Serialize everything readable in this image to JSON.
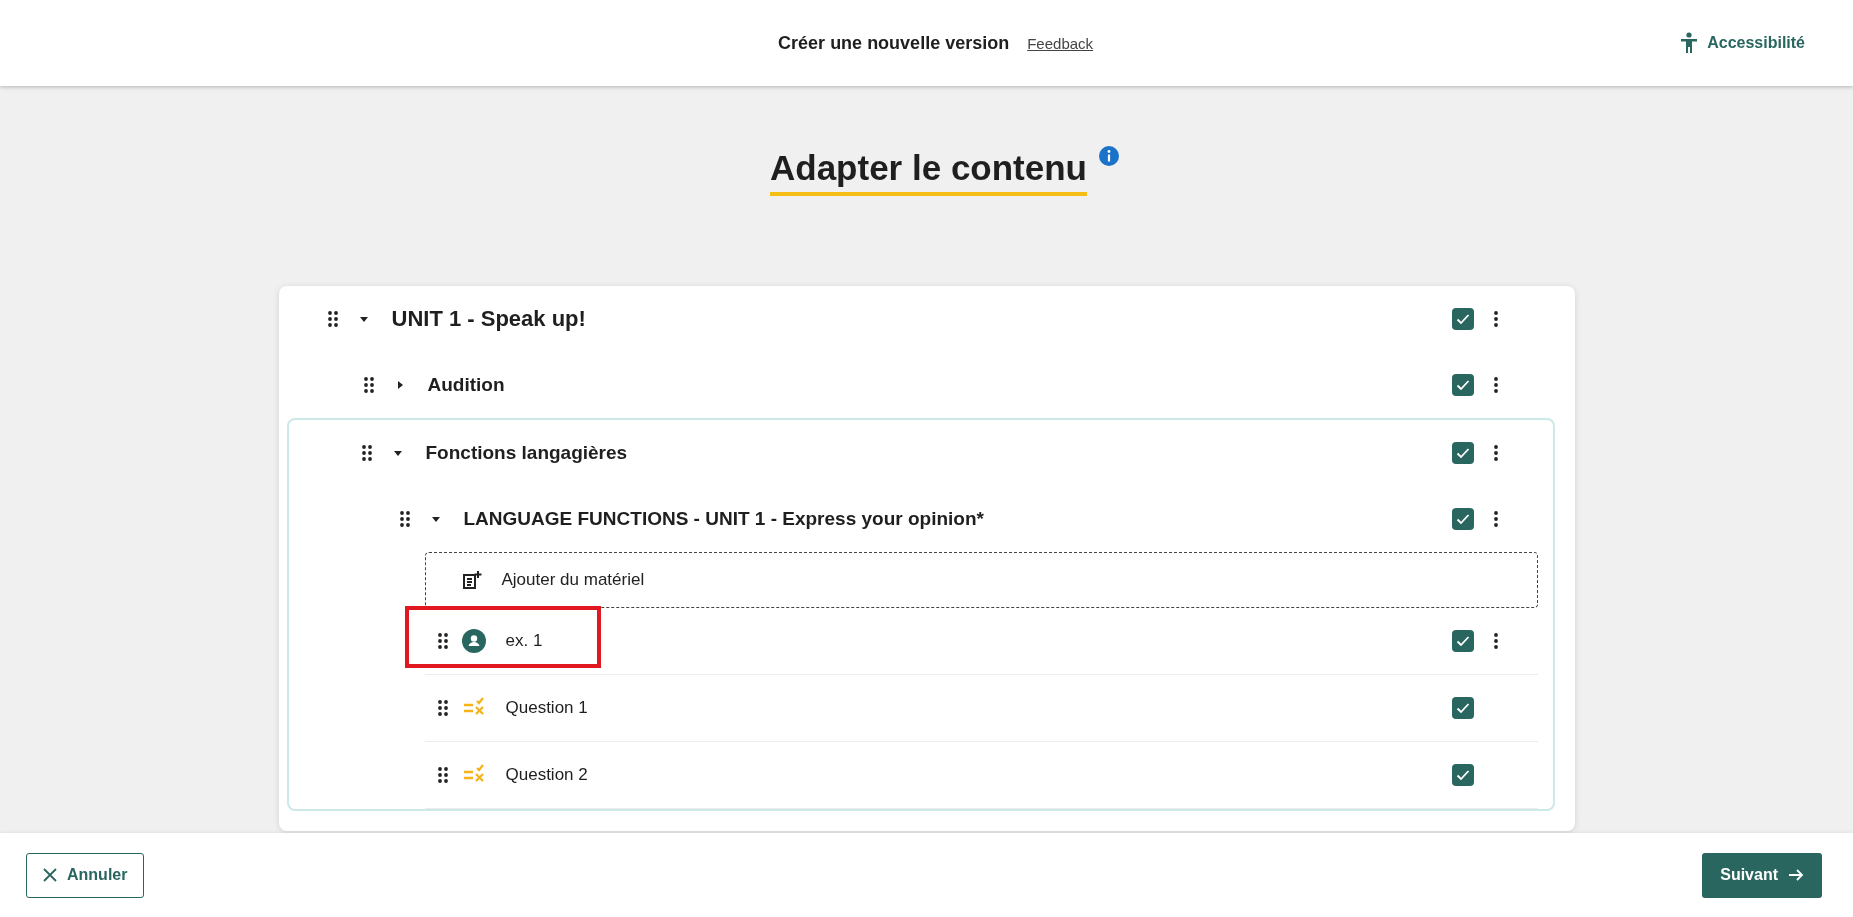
{
  "header": {
    "title": "Créer une nouvelle version",
    "feedback_link": "Feedback",
    "accessibility": "Accessibilité"
  },
  "page_title": "Adapter le contenu",
  "tree": [
    {
      "kind": "section",
      "label": "UNIT 1 - Speak up!",
      "expanded": true,
      "checked": true,
      "menu": true,
      "framed": false,
      "children": [
        {
          "kind": "section",
          "label": "Audition",
          "expanded": false,
          "checked": true,
          "menu": true,
          "framed": false
        },
        {
          "kind": "section",
          "label": "Fonctions langagières",
          "expanded": true,
          "checked": true,
          "menu": true,
          "framed": true,
          "children": [
            {
              "kind": "section",
              "label": "LANGUAGE FUNCTIONS - UNIT 1 - Express your opinion*",
              "expanded": true,
              "checked": true,
              "menu": true,
              "framed": false,
              "children": [
                {
                  "kind": "add-material",
                  "label": "Ajouter du matériel"
                },
                {
                  "kind": "exercise",
                  "label": "ex. 1",
                  "checked": true,
                  "menu": true,
                  "highlighted": true
                },
                {
                  "kind": "question",
                  "label": "Question 1",
                  "checked": true,
                  "menu": false,
                  "highlighted": false
                },
                {
                  "kind": "question",
                  "label": "Question 2",
                  "checked": true,
                  "menu": false,
                  "highlighted": false
                }
              ]
            }
          ]
        }
      ]
    }
  ],
  "footer": {
    "cancel": "Annuler",
    "next": "Suivant"
  }
}
